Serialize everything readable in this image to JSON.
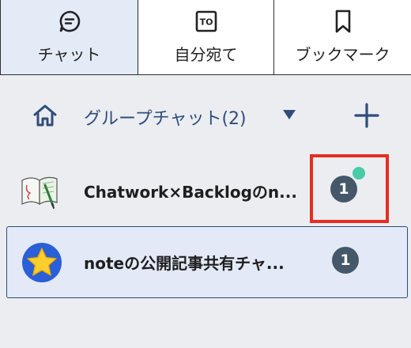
{
  "tabs": [
    {
      "label": "チャット",
      "icon": "chat-bubble-icon",
      "selected": true
    },
    {
      "label": "自分宛て",
      "icon": "to-icon",
      "icon_text": "TO"
    },
    {
      "label": "ブックマーク",
      "icon": "bookmark-icon"
    }
  ],
  "group_header": {
    "title": "グループチャット(2)",
    "home_icon": "home-icon",
    "dropdown_icon": "caret-down-icon",
    "add_icon": "plus-icon"
  },
  "rooms": [
    {
      "name": "Chatwork×Backlogのn...",
      "unread": "1",
      "avatar": "notebook-icon",
      "online": true
    },
    {
      "name": "noteの公開記事共有チャ...",
      "unread": "1",
      "avatar": "star-icon",
      "selected": true
    }
  ],
  "colors": {
    "accent": "#2f4d7a",
    "badge": "#445869",
    "online": "#48cba7",
    "highlight": "#e62d21",
    "selected_bg": "#e3e9f6"
  }
}
